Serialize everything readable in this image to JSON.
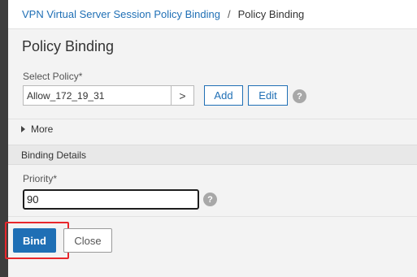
{
  "breadcrumb": {
    "parent": "VPN Virtual Server Session Policy Binding",
    "separator": "/",
    "current": "Policy Binding"
  },
  "page": {
    "title": "Policy Binding"
  },
  "policy": {
    "label": "Select Policy*",
    "value": "Allow_172_19_31",
    "arrow": ">",
    "add_label": "Add",
    "edit_label": "Edit",
    "help": "?"
  },
  "more": {
    "label": "More"
  },
  "binding_details": {
    "heading": "Binding Details",
    "priority_label": "Priority*",
    "priority_value": "90",
    "help": "?"
  },
  "footer": {
    "bind_label": "Bind",
    "close_label": "Close",
    "highlight_color": "#e8262b"
  },
  "colors": {
    "accent": "#1f6fb5",
    "left_bar": "#3e3e3e",
    "panel_bg": "#f3f3f3"
  }
}
